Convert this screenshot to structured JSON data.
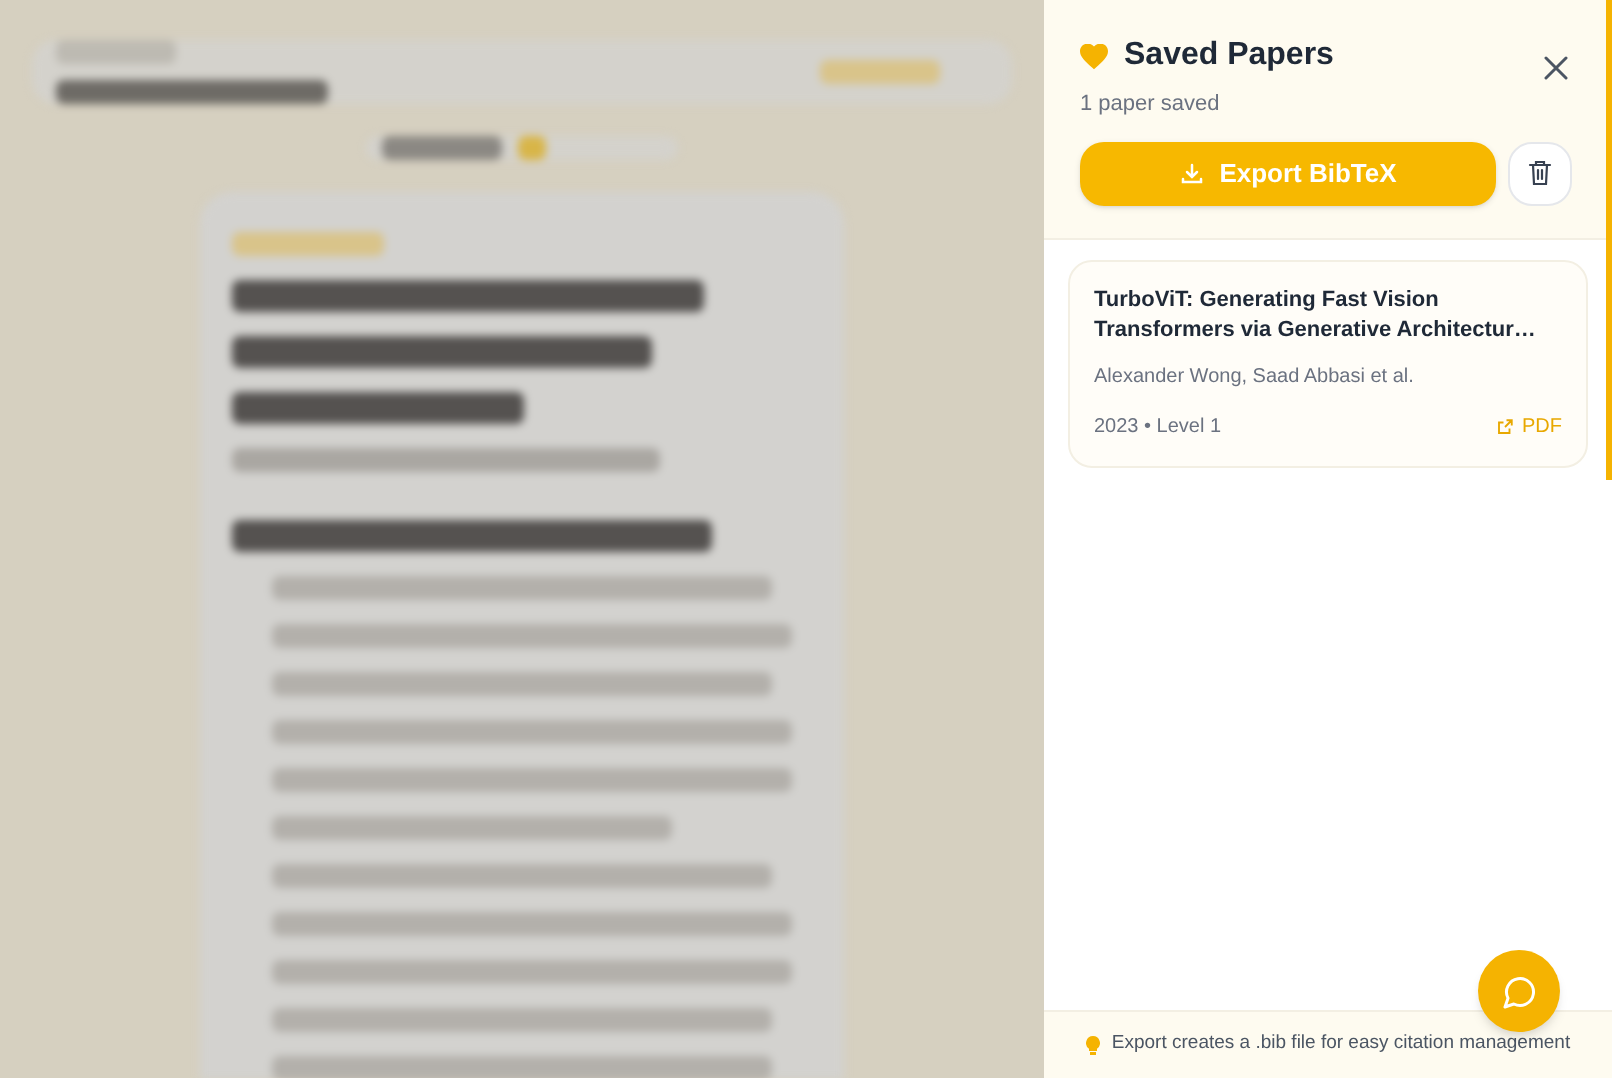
{
  "panel": {
    "title": "Saved Papers",
    "subtitle": "1 paper saved",
    "export_button": "Export BibTeX"
  },
  "papers": [
    {
      "title": "TurboViT: Generating Fast Vision Transformers via Generative Architectur…",
      "authors": "Alexander Wong, Saad Abbasi et al.",
      "meta": "2023 • Level 1",
      "link": "PDF"
    }
  ],
  "footer": {
    "tip": "Export creates a .bib file for easy citation management"
  }
}
